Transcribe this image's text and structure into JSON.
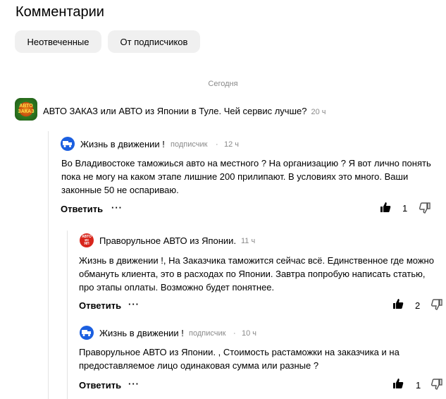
{
  "header": {
    "title": "Комментарии"
  },
  "filters": [
    "Неотвеченные",
    "От подписчиков"
  ],
  "date_label": "Сегодня",
  "post": {
    "title": "АВТО ЗАКАЗ или АВТО из Японии в Туле. Чей сервис лучше?",
    "time": "20 ч"
  },
  "comments": [
    {
      "author": "Жизнь в движении !",
      "badge": "подписчик",
      "time": "12 ч",
      "lines": [
        "Во Владивостоке таможиься авто на местного ? На организацию ? Я вот лично понять",
        "пока не могу на каком этапе лишние 200 прилипают. В условиях это много. Ваши",
        "законные 50 не оспариваю."
      ],
      "reply_label": "Ответить",
      "more": "···",
      "likes": "1"
    },
    {
      "author": "Праворульное АВТО из Японии.",
      "time": "11 ч",
      "lines": [
        "Жизнь в движении !, На Заказчика таможится  сейчас всё. Единственное где можно",
        "обмануть клиента, это в расходах по Японии.  Завтра попробую написать статью,",
        "про этапы оплаты.  Возможно будет понятнее."
      ],
      "reply_label": "Ответить",
      "more": "···",
      "likes": "2"
    },
    {
      "author": "Жизнь в движении !",
      "badge": "подписчик",
      "time": "10 ч",
      "lines": [
        "Праворульное АВТО из Японии.  , Стоимость растаможки на заказчика и на",
        "предоставляемое лицо одинаковая сумма или разные ?"
      ],
      "reply_label": "Ответить",
      "more": "···",
      "likes": "1"
    }
  ],
  "colors": {
    "avatar_blue": "#1b5fe0",
    "avatar_red": "#d8261c",
    "muted": "#8a8a8a",
    "pill_bg": "#f0f0f0"
  },
  "icons": [
    "truck-icon",
    "thumbs-up-icon",
    "thumbs-down-icon"
  ]
}
